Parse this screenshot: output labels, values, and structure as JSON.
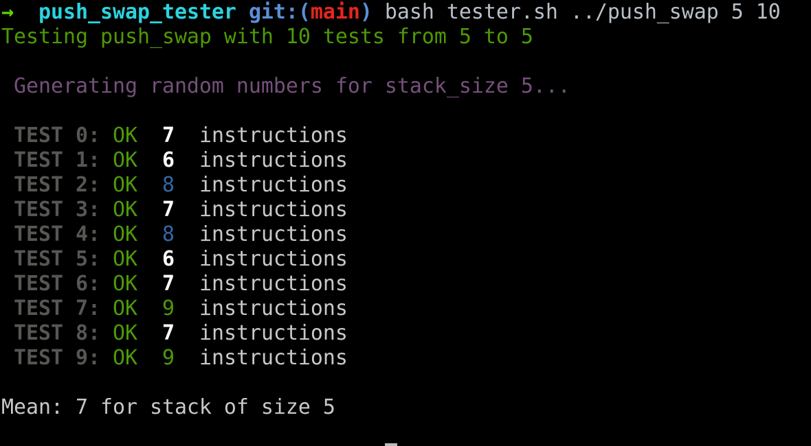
{
  "prompt": {
    "arrow_icon": "→",
    "cwd": "push_swap_tester",
    "git_prefix": "git:(",
    "branch": "main",
    "git_suffix": ")",
    "command": "bash tester.sh ../push_swap 5 10"
  },
  "header_line": "Testing push_swap with 10 tests from 5 to 5",
  "generating_line": " Generating random numbers for stack_size 5...",
  "tests": [
    {
      "label": " TEST 0: ",
      "status": "OK",
      "count": "7",
      "count_color": "white",
      "unit": "instructions"
    },
    {
      "label": " TEST 1: ",
      "status": "OK",
      "count": "6",
      "count_color": "white",
      "unit": "instructions"
    },
    {
      "label": " TEST 2: ",
      "status": "OK",
      "count": "8",
      "count_color": "blue",
      "unit": "instructions"
    },
    {
      "label": " TEST 3: ",
      "status": "OK",
      "count": "7",
      "count_color": "white",
      "unit": "instructions"
    },
    {
      "label": " TEST 4: ",
      "status": "OK",
      "count": "8",
      "count_color": "blue",
      "unit": "instructions"
    },
    {
      "label": " TEST 5: ",
      "status": "OK",
      "count": "6",
      "count_color": "white",
      "unit": "instructions"
    },
    {
      "label": " TEST 6: ",
      "status": "OK",
      "count": "7",
      "count_color": "white",
      "unit": "instructions"
    },
    {
      "label": " TEST 7: ",
      "status": "OK",
      "count": "9",
      "count_color": "green",
      "unit": "instructions"
    },
    {
      "label": " TEST 8: ",
      "status": "OK",
      "count": "7",
      "count_color": "white",
      "unit": "instructions"
    },
    {
      "label": " TEST 9: ",
      "status": "OK",
      "count": "9",
      "count_color": "green",
      "unit": "instructions"
    }
  ],
  "mean_line": "Mean: 7 for stack of size 5",
  "colors": {
    "background": "#000000",
    "prompt_arrow": "#5fd700",
    "cwd": "#2ad4e0",
    "git": "#5b8fd6",
    "branch": "#e8251f",
    "green": "#4e9a06",
    "purple": "#75507b",
    "test_label": "#555753",
    "count_white": "#ffffff",
    "count_blue": "#3465a4",
    "count_green": "#4e9a06"
  }
}
